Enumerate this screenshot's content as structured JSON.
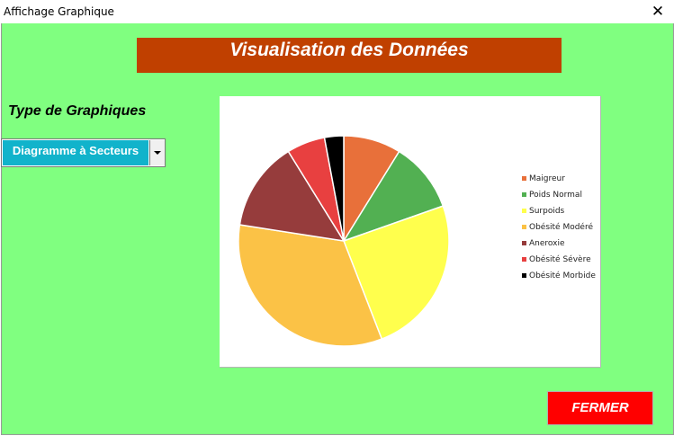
{
  "window": {
    "title": "Affichage Graphique",
    "close_glyph": "✕"
  },
  "banner": {
    "title": "Visualisation des Données"
  },
  "chart_type": {
    "label": "Type de Graphiques",
    "selected": "Diagramme à Secteurs"
  },
  "buttons": {
    "close_label": "FERMER"
  },
  "colors": {
    "background": "#80ff80",
    "banner": "#c04000",
    "combo_value": "#11b3cb",
    "close_button": "#ff0000"
  },
  "chart_data": {
    "type": "pie",
    "categories": [
      "Maigreur",
      "Poids Normal",
      "Surpoids",
      "Obésité Modéré",
      "Aneroxie",
      "Obésité Sévère",
      "Obésité Morbide"
    ],
    "values": [
      9,
      11,
      25,
      34,
      14,
      6,
      3
    ],
    "colors": [
      "#e8703a",
      "#52b052",
      "#ffff4d",
      "#fbc246",
      "#963c3c",
      "#e84040",
      "#000000"
    ],
    "legend": "right"
  }
}
